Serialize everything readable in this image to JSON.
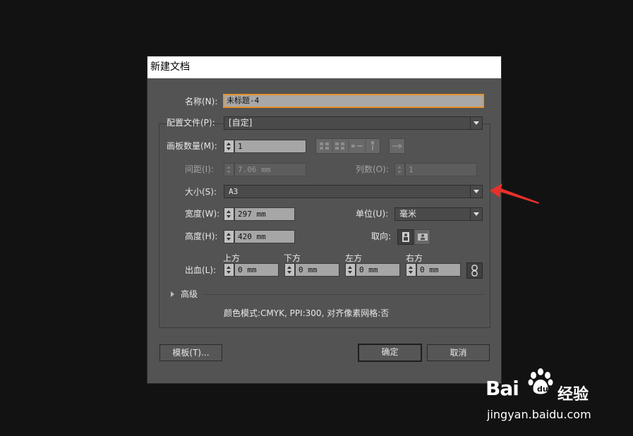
{
  "dialog": {
    "title": "新建文档",
    "name_label": "名称(N):",
    "name_value": "未标题-4",
    "profile_label": "配置文件(P):",
    "profile_value": "[自定]",
    "artboards_label": "画板数量(M):",
    "artboards_value": "1",
    "spacing_label": "间距(I):",
    "spacing_value": "7.06 mm",
    "columns_label": "列数(O):",
    "columns_value": "1",
    "size_label": "大小(S):",
    "size_value": "A3",
    "width_label": "宽度(W):",
    "width_value": "297 mm",
    "units_label": "单位(U):",
    "units_value": "毫米",
    "height_label": "高度(H):",
    "height_value": "420 mm",
    "orientation_label": "取向:",
    "bleed_label": "出血(L):",
    "bleed": {
      "top_label": "上方",
      "top_value": "0 mm",
      "bottom_label": "下方",
      "bottom_value": "0 mm",
      "left_label": "左方",
      "left_value": "0 mm",
      "right_label": "右方",
      "right_value": "0 mm"
    },
    "advanced_label": "高级",
    "summary": "颜色模式:CMYK, PPI:300, 对齐像素网格:否",
    "templates_button": "模板(T)...",
    "ok_button": "确定",
    "cancel_button": "取消"
  },
  "watermark": {
    "brand_prefix": "Bai",
    "brand_suffix": "经验",
    "url": "jingyan.baidu.com"
  },
  "colors": {
    "dialog_bg": "#535353",
    "field_active_border": "#e5912b",
    "annotation_arrow": "#e8302a"
  }
}
